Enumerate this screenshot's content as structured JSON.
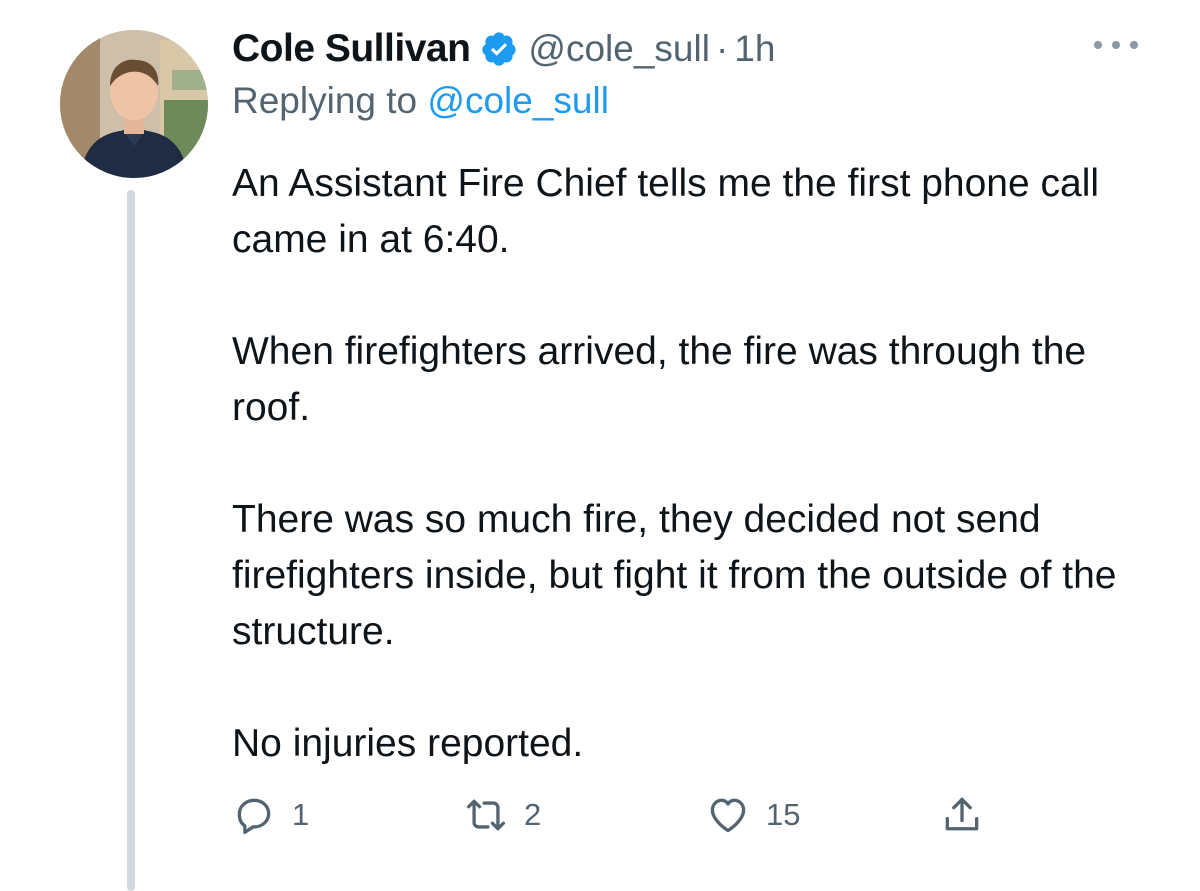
{
  "tweet": {
    "author": {
      "display_name": "Cole Sullivan",
      "handle": "@cole_sull",
      "verified": true,
      "avatar_icon": "profile-photo"
    },
    "separator": "·",
    "timestamp": "1h",
    "replying_prefix": "Replying to",
    "replying_to": "@cole_sull",
    "paragraphs": [
      "An Assistant Fire Chief tells me the first phone call came in at 6:40.",
      "When firefighters arrived, the fire was through the roof.",
      "There was so much fire, they decided not send firefighters inside, but fight it from the outside of the structure.",
      "No injuries reported."
    ],
    "actions": {
      "reply_count": "1",
      "retweet_count": "2",
      "like_count": "15"
    }
  },
  "colors": {
    "accent": "#1d9bf0",
    "text_primary": "#0f1419",
    "text_secondary": "#536471",
    "thread_line": "#cfd9de"
  },
  "icons": {
    "verified": "verified-badge-icon",
    "more": "more-icon",
    "reply": "reply-icon",
    "retweet": "retweet-icon",
    "like": "heart-icon",
    "share": "share-icon"
  }
}
